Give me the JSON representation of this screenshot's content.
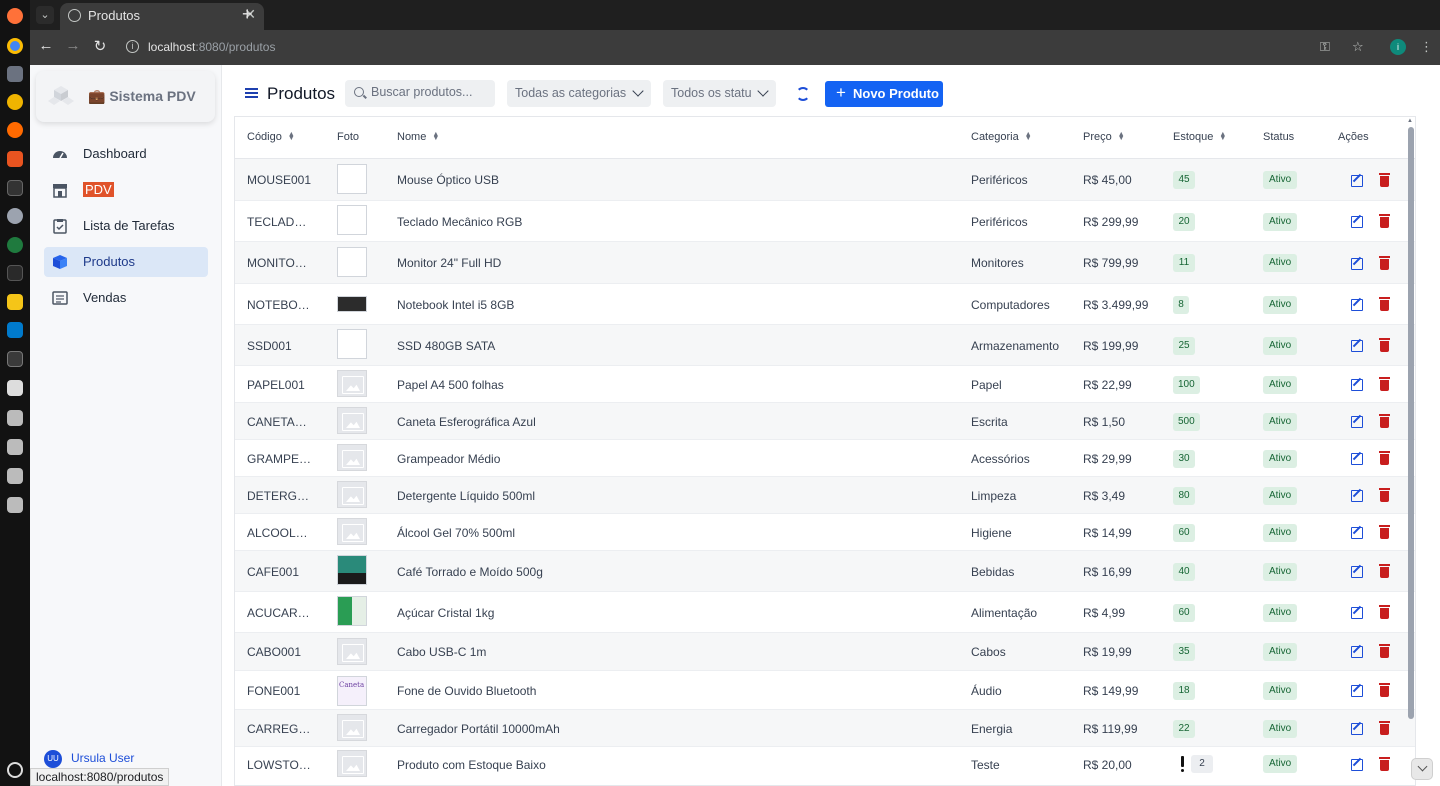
{
  "browser": {
    "tab_title": "Produtos",
    "url_host": "localhost",
    "url_path": ":8080/produtos",
    "status_url": "localhost:8080/produtos"
  },
  "sidebar": {
    "brand": "💼 Sistema PDV",
    "items": [
      {
        "label": "Dashboard",
        "icon": "gauge-icon"
      },
      {
        "label": "PDV",
        "icon": "store-icon"
      },
      {
        "label": "Lista de Tarefas",
        "icon": "clipboard-check-icon"
      },
      {
        "label": "Produtos",
        "icon": "box-icon"
      },
      {
        "label": "Vendas",
        "icon": "receipt-icon"
      }
    ],
    "user_initials": "UU",
    "user_name": "Ursula User"
  },
  "toolbar": {
    "title": "Produtos",
    "search_placeholder": "Buscar produtos...",
    "category_filter": "Todas as categorias",
    "status_filter": "Todos os status",
    "new_button": "Novo Produto",
    "accent": "#1463f3"
  },
  "table": {
    "headers": {
      "code": "Código",
      "photo": "Foto",
      "name": "Nome",
      "category": "Categoria",
      "price": "Preço",
      "stock": "Estoque",
      "status": "Status",
      "actions": "Ações"
    },
    "rows": [
      {
        "code": "MOUSE001",
        "name": "Mouse Óptico USB",
        "category": "Periféricos",
        "price": "R$ 45,00",
        "stock": "45",
        "status": "Ativo"
      },
      {
        "code": "TECLAD…",
        "name": "Teclado Mecânico RGB",
        "category": "Periféricos",
        "price": "R$ 299,99",
        "stock": "20",
        "status": "Ativo"
      },
      {
        "code": "MONITO…",
        "name": "Monitor 24\" Full HD",
        "category": "Monitores",
        "price": "R$ 799,99",
        "stock": "11",
        "status": "Ativo"
      },
      {
        "code": "NOTEBO…",
        "name": "Notebook Intel i5 8GB",
        "category": "Computadores",
        "price": "R$ 3.499,99",
        "stock": "8",
        "status": "Ativo"
      },
      {
        "code": "SSD001",
        "name": "SSD 480GB SATA",
        "category": "Armazenamento",
        "price": "R$ 199,99",
        "stock": "25",
        "status": "Ativo"
      },
      {
        "code": "PAPEL001",
        "name": "Papel A4 500 folhas",
        "category": "Papel",
        "price": "R$ 22,99",
        "stock": "100",
        "status": "Ativo"
      },
      {
        "code": "CANETA…",
        "name": "Caneta Esferográfica Azul",
        "category": "Escrita",
        "price": "R$ 1,50",
        "stock": "500",
        "status": "Ativo"
      },
      {
        "code": "GRAMPE…",
        "name": "Grampeador Médio",
        "category": "Acessórios",
        "price": "R$ 29,99",
        "stock": "30",
        "status": "Ativo"
      },
      {
        "code": "DETERG…",
        "name": "Detergente Líquido 500ml",
        "category": "Limpeza",
        "price": "R$ 3,49",
        "stock": "80",
        "status": "Ativo"
      },
      {
        "code": "ALCOOL…",
        "name": "Álcool Gel 70% 500ml",
        "category": "Higiene",
        "price": "R$ 14,99",
        "stock": "60",
        "status": "Ativo"
      },
      {
        "code": "CAFE001",
        "name": "Café Torrado e Moído 500g",
        "category": "Bebidas",
        "price": "R$ 16,99",
        "stock": "40",
        "status": "Ativo"
      },
      {
        "code": "ACUCAR…",
        "name": "Açúcar Cristal 1kg",
        "category": "Alimentação",
        "price": "R$ 4,99",
        "stock": "60",
        "status": "Ativo"
      },
      {
        "code": "CABO001",
        "name": "Cabo USB-C 1m",
        "category": "Cabos",
        "price": "R$ 19,99",
        "stock": "35",
        "status": "Ativo"
      },
      {
        "code": "FONE001",
        "name": "Fone de Ouvido Bluetooth",
        "category": "Áudio",
        "price": "R$ 149,99",
        "stock": "18",
        "status": "Ativo"
      },
      {
        "code": "CARREG…",
        "name": "Carregador Portátil 10000mAh",
        "category": "Energia",
        "price": "R$ 119,99",
        "stock": "22",
        "status": "Ativo"
      },
      {
        "code": "LOWSTO…",
        "name": "Produto com Estoque Baixo",
        "category": "Teste",
        "price": "R$ 20,00",
        "stock": "2",
        "status": "Ativo"
      }
    ]
  }
}
